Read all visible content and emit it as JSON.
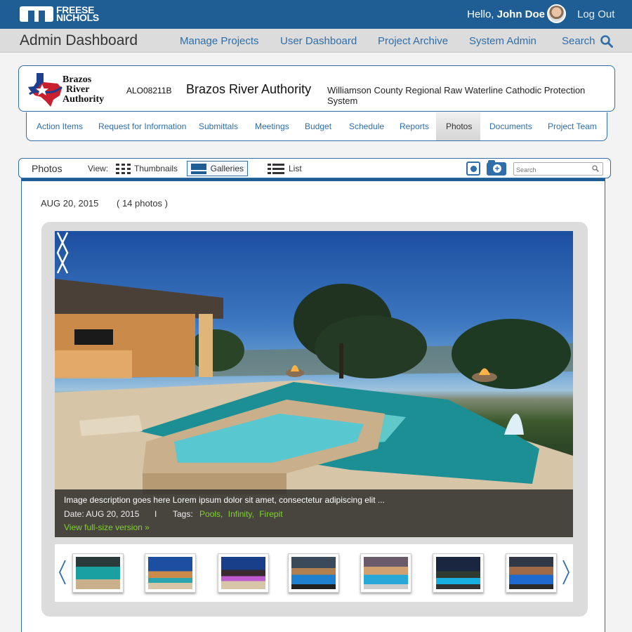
{
  "brand": {
    "line1": "FREESE",
    "line2": "NICHOLS"
  },
  "user": {
    "greeting": "Hello,",
    "name": "John Doe",
    "logout": "Log Out"
  },
  "nav": {
    "title": "Admin Dashboard",
    "links": [
      "Manage Projects",
      "User Dashboard",
      "Project Archive",
      "System Admin",
      "Search"
    ]
  },
  "project": {
    "logo_lines": [
      "Brazos",
      "River",
      "Authority"
    ],
    "code": "ALO08211B",
    "name": "Brazos River Authority",
    "description": "Williamson County Regional Raw Waterline Cathodic Protection System"
  },
  "tabs": [
    "Action Items",
    "Request for Information",
    "Submittals",
    "Meetings",
    "Budget",
    "Schedule",
    "Reports",
    "Photos",
    "Documents",
    "Project Team"
  ],
  "active_tab": "Photos",
  "photos_toolbar": {
    "label": "Photos",
    "view_label": "View:",
    "views": [
      "Thumbnails",
      "Galleries",
      "List"
    ],
    "active_view": "Galleries",
    "search_placeholder": "Search"
  },
  "album": {
    "date": "AUG 20, 2015",
    "count": "( 14 photos )"
  },
  "caption": {
    "description": "Image description goes here  Lorem ipsum dolor sit amet, consectetur adipiscing elit ...",
    "date": "Date: AUG 20, 2015",
    "separator": "I",
    "tags_label": "Tags:",
    "tags": [
      "Pools,",
      "Infinity,",
      "Firepit"
    ],
    "view_full": "View full-size version »"
  },
  "colors": {
    "brand_blue": "#1f5d95",
    "link_blue": "#2f6ea8",
    "tag_green": "#7dd32a"
  },
  "thumbnail_count": 7
}
